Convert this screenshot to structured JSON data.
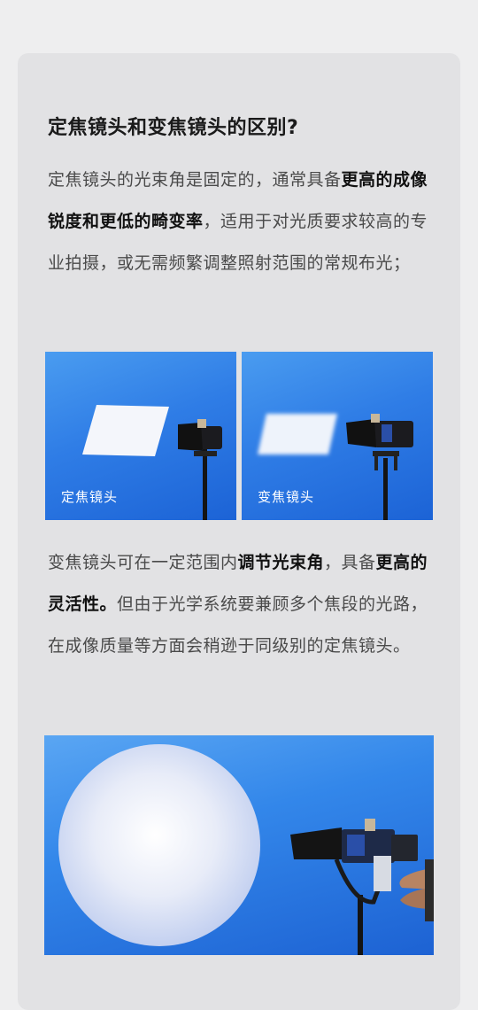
{
  "title": "定焦镜头和变焦镜头的区别?",
  "para1": {
    "a": "定焦镜头的光束角是固定的，通常具备",
    "b": "更高的成像锐度和更低的畸变率",
    "c": "，适用于对光质要求较高的专业拍摄，或无需频繁调整照射范围的常规布光；"
  },
  "images": {
    "left_caption": "定焦镜头",
    "right_caption": "变焦镜头"
  },
  "para2": {
    "a": "变焦镜头可在一定范围内",
    "b": "调节光束角",
    "c": "，具备",
    "d": "更高的灵活性。",
    "e": "但由于光学系统要兼顾多个焦段的光路，在成像质量等方面会稍逊于同级别的定焦镜头。"
  },
  "colors": {
    "background": "#eeeeef",
    "card": "#e2e2e4",
    "photo_blue": "#2f7de6"
  }
}
